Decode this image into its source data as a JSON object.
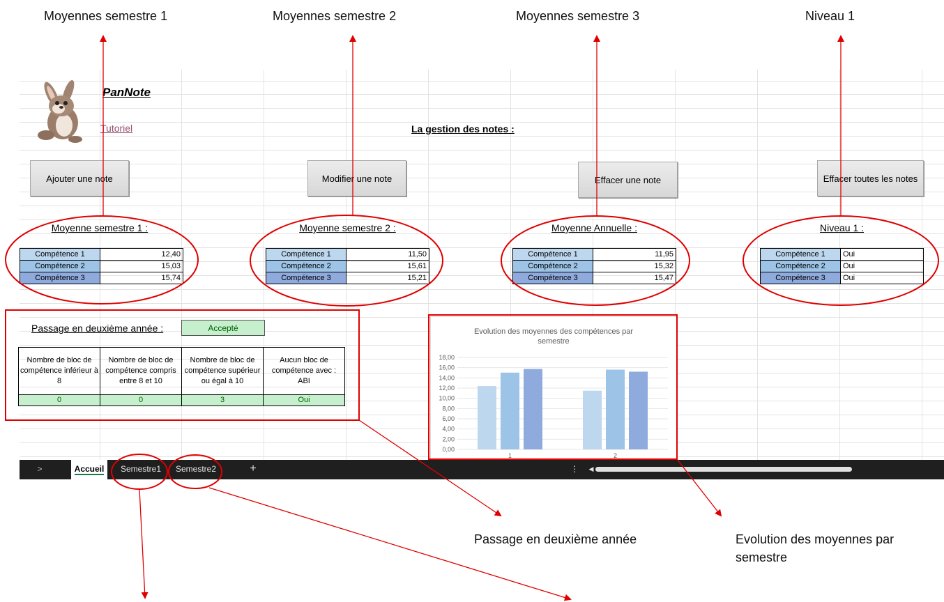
{
  "callouts": {
    "top": [
      "Moyennes semestre 1",
      "Moyennes semestre 2",
      "Moyennes semestre 3",
      "Niveau 1"
    ],
    "passage": "Passage en deuxième année",
    "evolution_line1": "Evolution des moyennes par",
    "evolution_line2": "semestre"
  },
  "header": {
    "title": "PanNote",
    "tutorial_link": "Tutoriel",
    "main_title": "La gestion des notes :"
  },
  "buttons": {
    "add": "Ajouter une note",
    "modify": "Modifier une note",
    "delete": "Effacer une note",
    "delete_all": "Effacer toutes les notes"
  },
  "sections": {
    "s1": "Moyenne semestre 1 :",
    "s2": "Moyenne semestre 2 :",
    "annual": "Moyenne Annuelle :",
    "level": "Niveau 1 :"
  },
  "competences": [
    "Compétence 1",
    "Compétence 2",
    "Compétence 3"
  ],
  "values": {
    "s1": [
      "12,40",
      "15,03",
      "15,74"
    ],
    "s2": [
      "11,50",
      "15,61",
      "15,21"
    ],
    "annual": [
      "11,95",
      "15,32",
      "15,47"
    ],
    "level": [
      "Oui",
      "Oui",
      "Oui"
    ]
  },
  "passage": {
    "label": "Passage en deuxième année :",
    "status": "Accepté",
    "headers": [
      "Nombre de bloc de compétence inférieur à 8",
      "Nombre de bloc de compétence compris entre 8 et 10",
      "Nombre de bloc de compétence supérieur ou égal à 10",
      "Aucun bloc de compétence avec : ABI"
    ],
    "values": [
      "0",
      "0",
      "3",
      "Oui"
    ]
  },
  "colors": {
    "comp1": "#bdd7ee",
    "comp2": "#9dc3e6",
    "comp3": "#8faadc",
    "green_fill": "#c6efce",
    "green_text": "#006100",
    "annotation": "#e00000",
    "tabbar": "#1f1f1f"
  },
  "chart_data": {
    "type": "bar",
    "title": "Evolution des moyennes des compétences par semestre",
    "categories": [
      "1",
      "2"
    ],
    "series": [
      {
        "values": [
          12.4,
          11.5
        ],
        "color": "#bdd7ee"
      },
      {
        "values": [
          15.03,
          15.61
        ],
        "color": "#9dc3e6"
      },
      {
        "values": [
          15.74,
          15.21
        ],
        "color": "#8faadc"
      }
    ],
    "ylim": [
      0,
      18
    ],
    "yticks": [
      "0,00",
      "2,00",
      "4,00",
      "6,00",
      "8,00",
      "10,00",
      "12,00",
      "14,00",
      "16,00",
      "18,00"
    ],
    "grid": true
  },
  "tabs": {
    "active": "Accueil",
    "sheet1": "Semestre1",
    "sheet2": "Semestre2",
    "add": "+",
    "nav": ">",
    "more": "⋮",
    "scroll_left": "◀"
  }
}
